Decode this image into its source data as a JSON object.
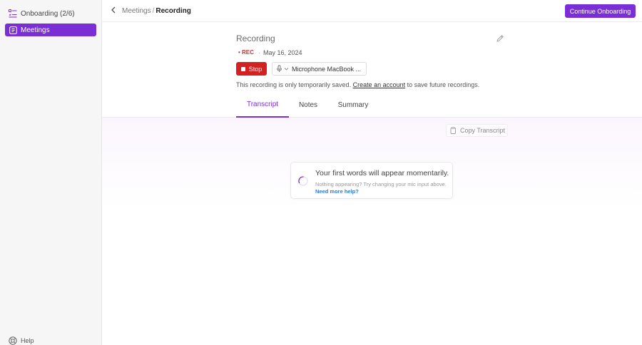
{
  "sidebar": {
    "onboarding_label": "Onboarding (2/6)",
    "meetings_label": "Meetings",
    "help_label": "Help"
  },
  "header": {
    "breadcrumb_parent": "Meetings",
    "breadcrumb_sep": "/",
    "breadcrumb_current": "Recording",
    "continue_label": "Continue Onboarding"
  },
  "meeting": {
    "title": "Recording",
    "rec_label": "• REC",
    "date_dot": "·",
    "date": "May 16, 2024",
    "stop_label": "Stop",
    "mic_value": "Microphone MacBook ...",
    "notice_text": "This recording is only temporarily saved.",
    "notice_link": "Create an account",
    "notice_suffix": "to save future recordings."
  },
  "tabs": [
    {
      "label": "Transcript",
      "active": true
    },
    {
      "label": "Notes",
      "active": false
    },
    {
      "label": "Summary",
      "active": false
    }
  ],
  "transcript": {
    "copy_label": "Copy Transcript",
    "empty_title": "Your first words will appear momentarily.",
    "empty_sub": "Nothing appearing? Try changing your mic input above.",
    "help_link": "Need more help?"
  },
  "colors": {
    "accent": "#7a2fd6",
    "stop": "#d32020",
    "rec": "#d32f2f",
    "link": "#2f7bd8"
  },
  "icons": [
    "onboarding-icon",
    "meetings-icon",
    "help-icon",
    "back-icon",
    "edit-icon",
    "stop-square-icon",
    "mic-icon",
    "chevron-down-icon",
    "copy-icon",
    "spinner-icon"
  ]
}
